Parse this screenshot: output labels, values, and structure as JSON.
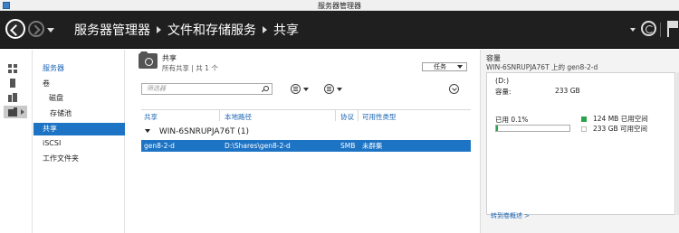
{
  "window": {
    "title": "服务器管理器"
  },
  "breadcrumb": {
    "items": [
      "服务器管理器",
      "文件和存储服务",
      "共享"
    ]
  },
  "nav": {
    "items": [
      {
        "label": "服务器",
        "level": 0,
        "selected": false
      },
      {
        "label": "卷",
        "level": 0,
        "selected": false
      },
      {
        "label": "磁盘",
        "level": 1,
        "selected": false
      },
      {
        "label": "存储池",
        "level": 1,
        "selected": false
      },
      {
        "label": "共享",
        "level": 0,
        "selected": true
      },
      {
        "label": "iSCSI",
        "level": 0,
        "selected": false
      },
      {
        "label": "工作文件夹",
        "level": 0,
        "selected": false
      }
    ]
  },
  "shares": {
    "title": "共享",
    "subtitle": "所有共享 | 共 1 个",
    "tasks_label": "任务",
    "filter_placeholder": "筛选器",
    "columns": [
      "共享",
      "本地路径",
      "协议",
      "可用性类型"
    ],
    "group_label": "WIN-6SNRUPJA76T (1)",
    "rows": [
      {
        "share": "gen8-2-d",
        "path": "D:\\Shares\\gen8-2-d",
        "protocol": "SMB",
        "availability": "未群集"
      }
    ]
  },
  "volume": {
    "title": "容量",
    "subtitle": "WIN-6SNRUPJA76T 上的 gen8-2-d",
    "drive": "(D:)",
    "capacity_label": "容量:",
    "capacity_value": "233 GB",
    "used_label": "已用 0.1%",
    "used_fraction": 0.001,
    "used_legend": "124 MB 已用空间",
    "free_legend": "233 GB 可用空间",
    "link": "转到卷概述 >"
  },
  "colors": {
    "accent": "#1d73c4",
    "link": "#1b64b4",
    "used": "#2aa34a",
    "header_bg": "#1f1f1f"
  },
  "icons": {
    "rail": [
      "dashboard-icon",
      "local-server-icon",
      "all-servers-icon",
      "file-storage-icon"
    ]
  }
}
